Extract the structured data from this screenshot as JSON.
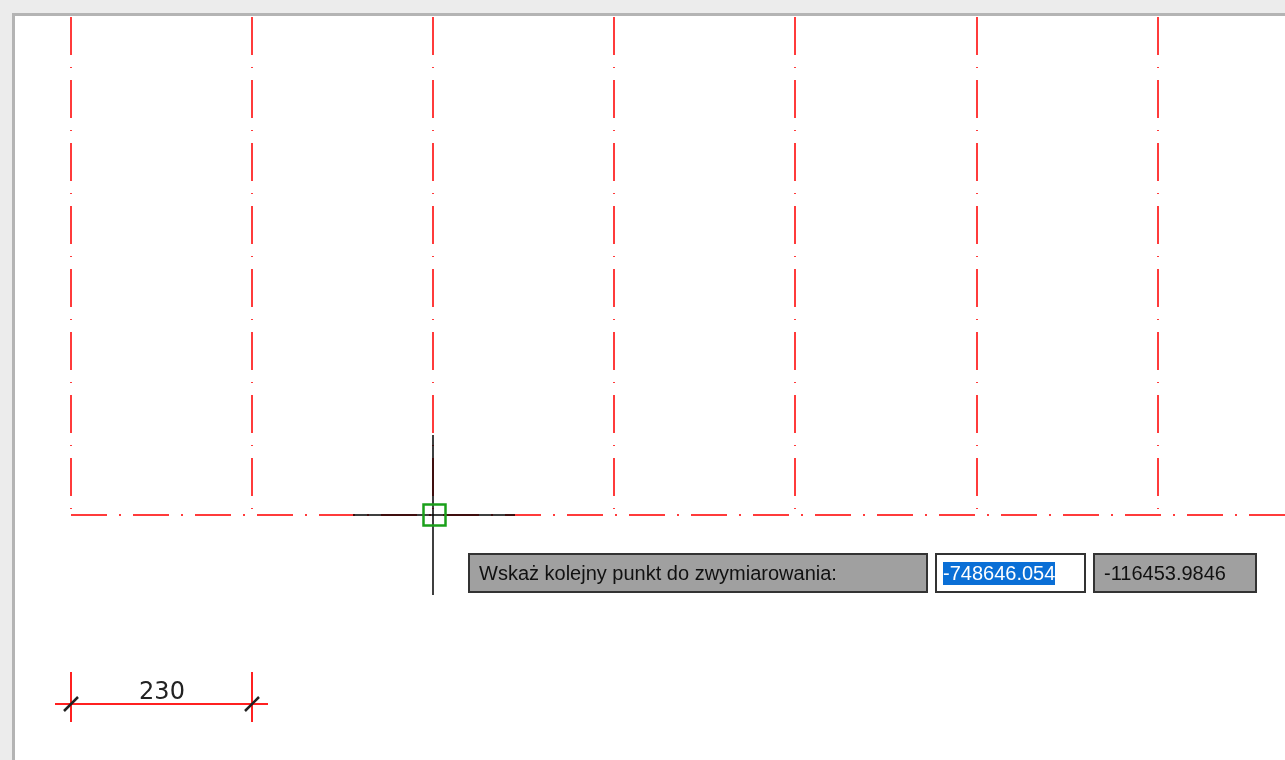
{
  "dimension": {
    "text": "230"
  },
  "prompt": {
    "label": "Wskaż kolejny punkt do zwymiarowania:",
    "x_value": "-748646.054",
    "x_selected": true,
    "y_value": "-116453.9846"
  }
}
